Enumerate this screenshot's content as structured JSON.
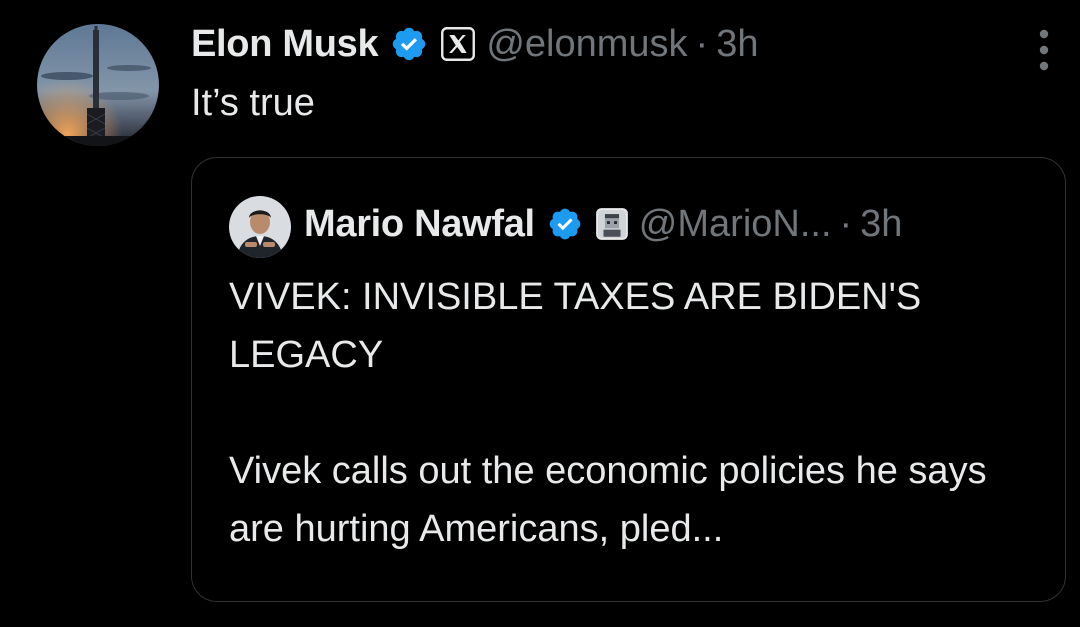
{
  "tweet": {
    "author": {
      "display_name": "Elon Musk",
      "handle": "@elonmusk",
      "verified_icon": "verified-badge-icon",
      "affiliate_icon": "x-logo-icon"
    },
    "separator": "·",
    "timestamp": "3h",
    "text": "It’s true",
    "more_icon": "more-options-icon"
  },
  "quote": {
    "author": {
      "display_name": "Mario Nawfal",
      "handle": "@MarioN...",
      "verified_icon": "verified-badge-icon",
      "affiliate_icon": "affiliate-avatar-icon"
    },
    "separator": "·",
    "timestamp": "3h",
    "text": "VIVEK: INVISIBLE TAXES ARE BIDEN'S LEGACY\n\nVivek calls out the economic policies he says are hurting Americans, pled..."
  },
  "colors": {
    "background": "#000000",
    "primary_text": "#e7e9ea",
    "secondary_text": "#71767b",
    "verified_blue": "#1d9bf0",
    "card_border": "#2f3336"
  }
}
